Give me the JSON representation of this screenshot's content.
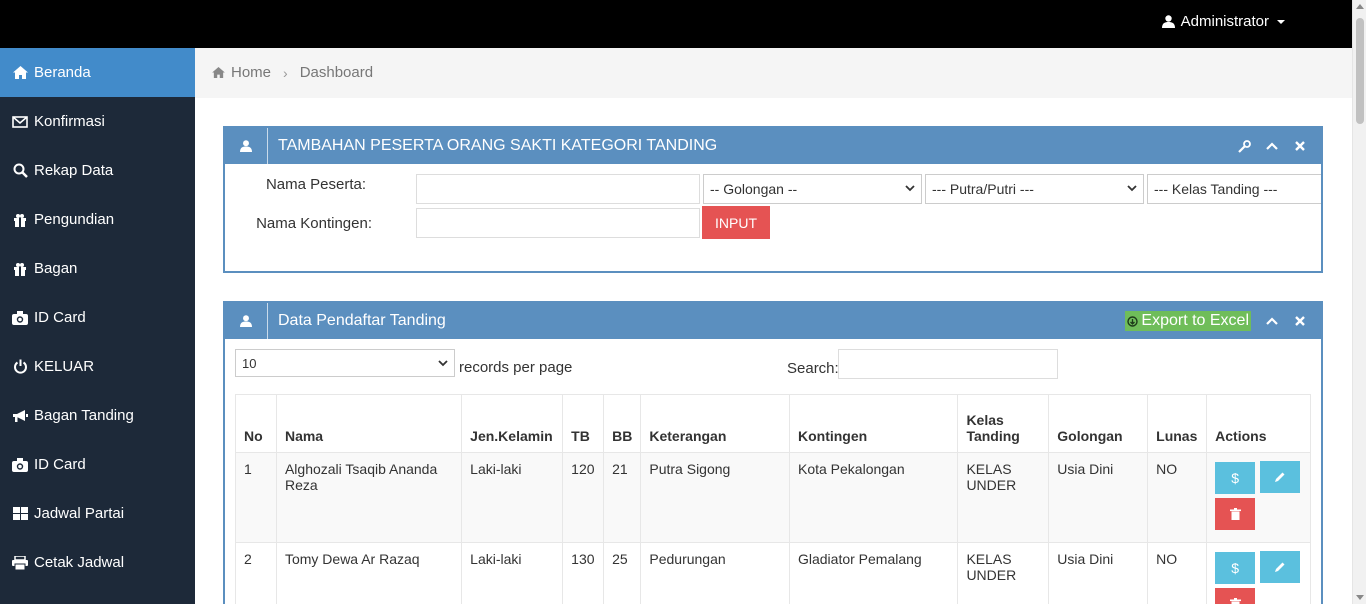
{
  "topbar": {
    "user_label": "Administrator"
  },
  "sidebar": {
    "items": [
      {
        "label": "Beranda",
        "icon": "home-icon"
      },
      {
        "label": "Konfirmasi",
        "icon": "envelope-icon"
      },
      {
        "label": "Rekap Data",
        "icon": "search-icon"
      },
      {
        "label": "Pengundian",
        "icon": "gift-icon"
      },
      {
        "label": "Bagan",
        "icon": "gift-icon"
      },
      {
        "label": "ID Card",
        "icon": "camera-icon"
      },
      {
        "label": "KELUAR",
        "icon": "power-icon"
      },
      {
        "label": "Bagan Tanding",
        "icon": "bullhorn-icon"
      },
      {
        "label": "ID Card",
        "icon": "camera-icon"
      },
      {
        "label": "Jadwal Partai",
        "icon": "grid-icon"
      },
      {
        "label": "Cetak Jadwal",
        "icon": "print-icon"
      }
    ]
  },
  "breadcrumb": {
    "home": "Home",
    "current": "Dashboard"
  },
  "panel_add": {
    "title": "TAMBAHAN PESERTA ORANG SAKTI KATEGORI TANDING",
    "label_nama": "Nama Peserta:",
    "label_kontingen": "Nama Kontingen:",
    "select_golongan": "-- Golongan --",
    "select_putra": "--- Putra/Putri ---",
    "select_kelas": "--- Kelas Tanding ---",
    "input_button": "INPUT"
  },
  "panel_data": {
    "title": "Data Pendaftar Tanding",
    "export_label": "Export to Excel",
    "records_value": "10",
    "records_label": "records per page",
    "search_label": "Search:",
    "columns": [
      "No",
      "Nama",
      "Jen.Kelamin",
      "TB",
      "BB",
      "Keterangan",
      "Kontingen",
      "Kelas Tanding",
      "Golongan",
      "Lunas",
      "Actions"
    ],
    "rows": [
      {
        "no": "1",
        "nama": "Alghozali Tsaqib Ananda Reza",
        "jk": "Laki-laki",
        "tb": "120",
        "bb": "21",
        "ket": "Putra Sigong",
        "kontingen": "Kota Pekalongan",
        "kelas": "KELAS UNDER",
        "golongan": "Usia Dini",
        "lunas": "NO"
      },
      {
        "no": "2",
        "nama": "Tomy Dewa Ar Razaq",
        "jk": "Laki-laki",
        "tb": "130",
        "bb": "25",
        "ket": "Pedurungan",
        "kontingen": "Gladiator Pemalang",
        "kelas": "KELAS UNDER",
        "golongan": "Usia Dini",
        "lunas": "NO"
      }
    ]
  },
  "colors": {
    "sidebar": "#1d2939",
    "active": "#428bca",
    "panel": "#5b8fbf",
    "danger": "#e55353",
    "info": "#5bc0de",
    "success": "#6fbd5a"
  }
}
